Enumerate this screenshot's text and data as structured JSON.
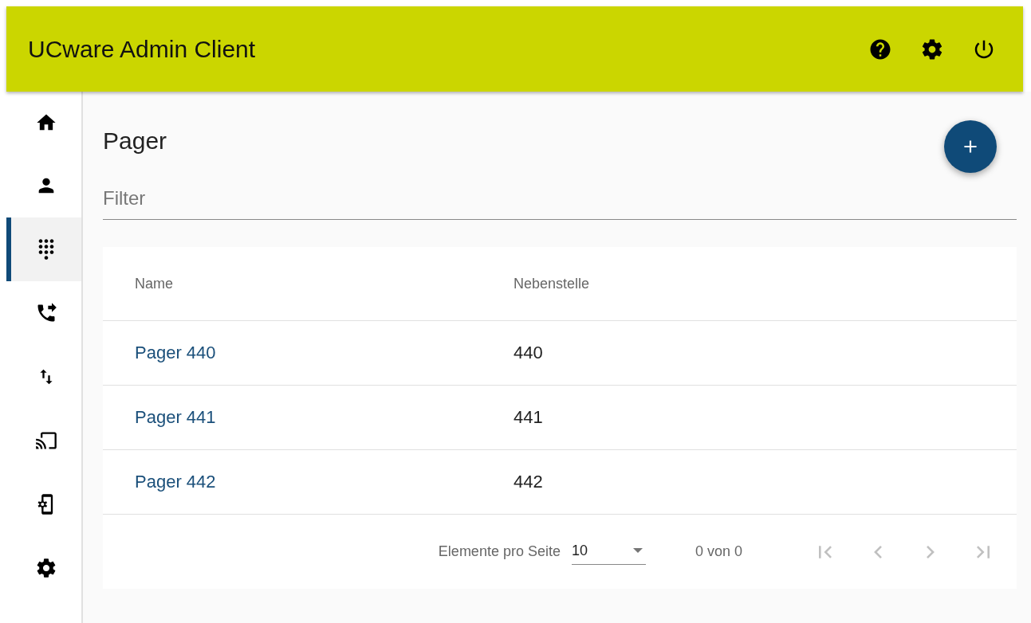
{
  "header": {
    "title": "UCware Admin Client"
  },
  "sidebar": {
    "items": [
      {
        "kind": "home",
        "selected": false
      },
      {
        "kind": "user",
        "selected": false
      },
      {
        "kind": "dialpad",
        "selected": true
      },
      {
        "kind": "forward",
        "selected": false
      },
      {
        "kind": "updown",
        "selected": false
      },
      {
        "kind": "cast",
        "selected": false
      },
      {
        "kind": "device",
        "selected": false
      },
      {
        "kind": "settings",
        "selected": false
      }
    ]
  },
  "page": {
    "title": "Pager",
    "filter": {
      "placeholder": "Filter"
    }
  },
  "table": {
    "columns": [
      "Name",
      "Nebenstelle"
    ],
    "rows": [
      {
        "name": "Pager 440",
        "extension": "440"
      },
      {
        "name": "Pager 441",
        "extension": "441"
      },
      {
        "name": "Pager 442",
        "extension": "442"
      }
    ]
  },
  "paginator": {
    "label": "Elemente pro Seite",
    "page_size": "10",
    "range": "0 von 0",
    "disabled": true
  }
}
